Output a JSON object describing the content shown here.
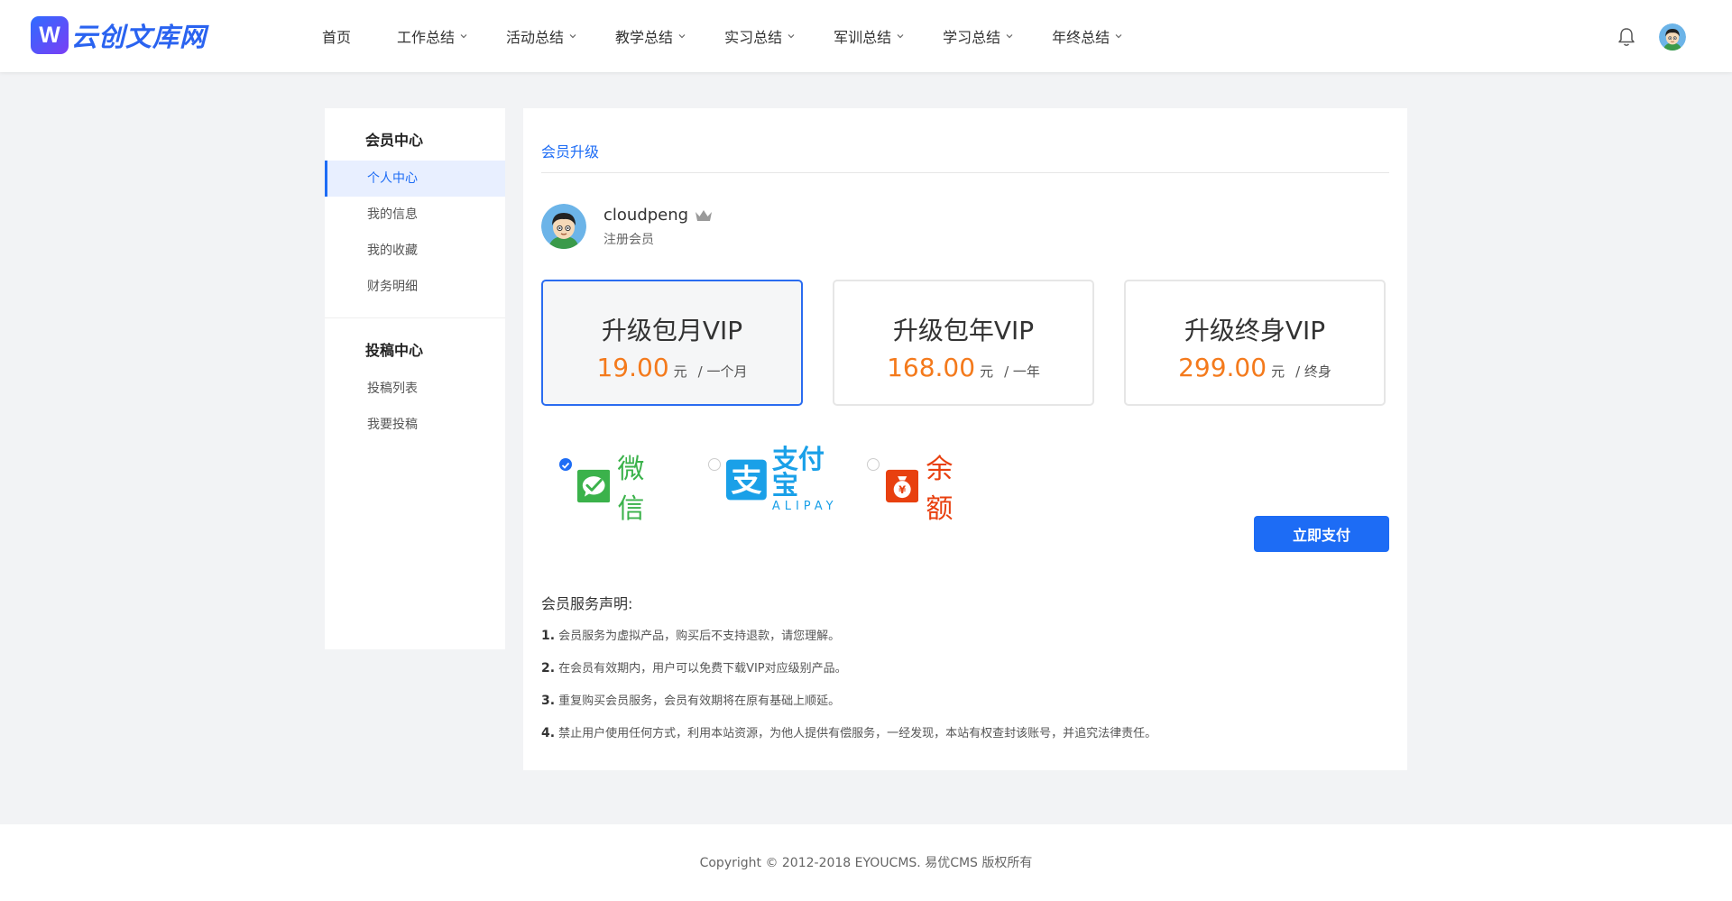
{
  "site": {
    "logo_letter": "W",
    "logo_text": "云创文库网"
  },
  "nav": {
    "items": [
      {
        "label": "首页",
        "has_dropdown": false
      },
      {
        "label": "工作总结",
        "has_dropdown": true
      },
      {
        "label": "活动总结",
        "has_dropdown": true
      },
      {
        "label": "教学总结",
        "has_dropdown": true
      },
      {
        "label": "实习总结",
        "has_dropdown": true
      },
      {
        "label": "军训总结",
        "has_dropdown": true
      },
      {
        "label": "学习总结",
        "has_dropdown": true
      },
      {
        "label": "年终总结",
        "has_dropdown": true
      }
    ],
    "icons": [
      "bell-icon",
      "avatar"
    ]
  },
  "sidebar": {
    "groups": [
      {
        "title": "会员中心",
        "items": [
          {
            "label": "个人中心",
            "active": true
          },
          {
            "label": "我的信息",
            "active": false
          },
          {
            "label": "我的收藏",
            "active": false
          },
          {
            "label": "财务明细",
            "active": false
          }
        ]
      },
      {
        "title": "投稿中心",
        "items": [
          {
            "label": "投稿列表",
            "active": false
          },
          {
            "label": "我要投稿",
            "active": false
          }
        ]
      }
    ]
  },
  "main": {
    "tab_title": "会员升级",
    "user": {
      "name": "cloudpeng",
      "level": "注册会员",
      "badge_icon": "crown-icon"
    },
    "plans": [
      {
        "name": "升级包月VIP",
        "price": "19.00",
        "unit": "元",
        "period": "/ 一个月",
        "selected": true
      },
      {
        "name": "升级包年VIP",
        "price": "168.00",
        "unit": "元",
        "period": "/ 一年",
        "selected": false
      },
      {
        "name": "升级终身VIP",
        "price": "299.00",
        "unit": "元",
        "period": "/ 终身",
        "selected": false
      }
    ],
    "payment_methods": [
      {
        "label": "微信",
        "icon": "wechat-icon",
        "checked": true,
        "color": "#3bb24b"
      },
      {
        "label": "支付宝",
        "sublabel": "ALIPAY",
        "icon": "alipay-icon",
        "checked": false,
        "color": "#1aa0e8"
      },
      {
        "label": "余额",
        "icon": "balance-icon",
        "checked": false,
        "color": "#e8400f"
      }
    ],
    "pay_button": "立即支付",
    "notice": {
      "title": "会员服务声明:",
      "items": [
        {
          "num": "1.",
          "text": "会员服务为虚拟产品，购买后不支持退款，请您理解。"
        },
        {
          "num": "2.",
          "text": "在会员有效期内，用户可以免费下载VIP对应级别产品。"
        },
        {
          "num": "3.",
          "text": "重复购买会员服务，会员有效期将在原有基础上顺延。"
        },
        {
          "num": "4.",
          "text": "禁止用户使用任何方式，利用本站资源，为他人提供有偿服务，一经发现，本站有权查封该账号，并追究法律责任。"
        }
      ]
    }
  },
  "footer": {
    "copyright": "Copyright © 2012-2018 EYOUCMS. 易优CMS 版权所有"
  },
  "colors": {
    "accent": "#1d6cf5",
    "price": "#f47a1c",
    "background": "#f2f3f5"
  }
}
